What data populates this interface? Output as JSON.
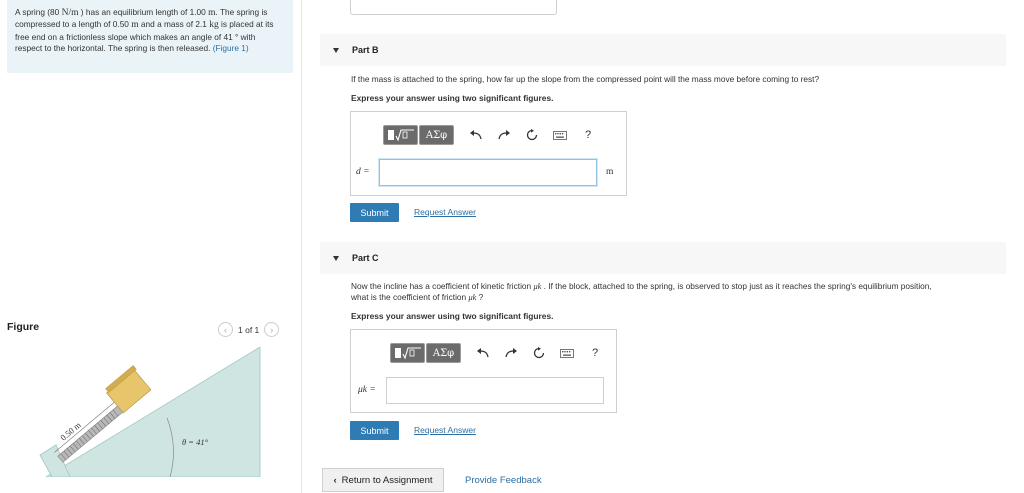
{
  "problem": {
    "s1": "A spring (80 ",
    "u1": "N/m",
    "s2": " ) has an equilibrium length of 1.00 ",
    "u2": "m",
    "s3": ". The spring is compressed to a length of 0.50 ",
    "u3": "m",
    "s4": " and a mass of 2.1 ",
    "u4": "kg",
    "s5": " is placed at its free end on a frictionless slope which makes an angle of 41 ",
    "u5": "°",
    "s6": " with respect to the horizontal. The spring is then released. ",
    "link": "(Figure 1)"
  },
  "figure": {
    "title": "Figure",
    "pager": "1 of 1",
    "length_label": "0.50 m",
    "angle_label": "θ = 41°"
  },
  "partB": {
    "title": "Part B",
    "question": "If the mass is attached to the spring, how far up the slope from the compressed point will the mass move before coming to rest?",
    "instruction": "Express your answer using two significant figures.",
    "var": "d =",
    "unit": "m",
    "submit": "Submit",
    "request": "Request Answer"
  },
  "partC": {
    "title": "Part C",
    "q1": "Now the incline has a coefficient of kinetic friction ",
    "q2": " . If the block, attached to the spring, is observed to stop just as it reaches the spring's equilibrium position,",
    "q3": "what is the coefficient of friction ",
    "q4": " ?",
    "mu": "μk",
    "instruction": "Express your answer using two significant figures.",
    "var": "μk =",
    "submit": "Submit",
    "request": "Request Answer"
  },
  "toolbar": {
    "symbols": "ΑΣφ",
    "help": "?"
  },
  "footer": {
    "return": "Return to Assignment",
    "feedback": "Provide Feedback"
  },
  "colors": {
    "accent": "#2f7bb4",
    "link": "#2d6ea3",
    "problem_bg": "#eaf4f8",
    "incline": "#cfe5e2",
    "block": "#e7c66b"
  }
}
